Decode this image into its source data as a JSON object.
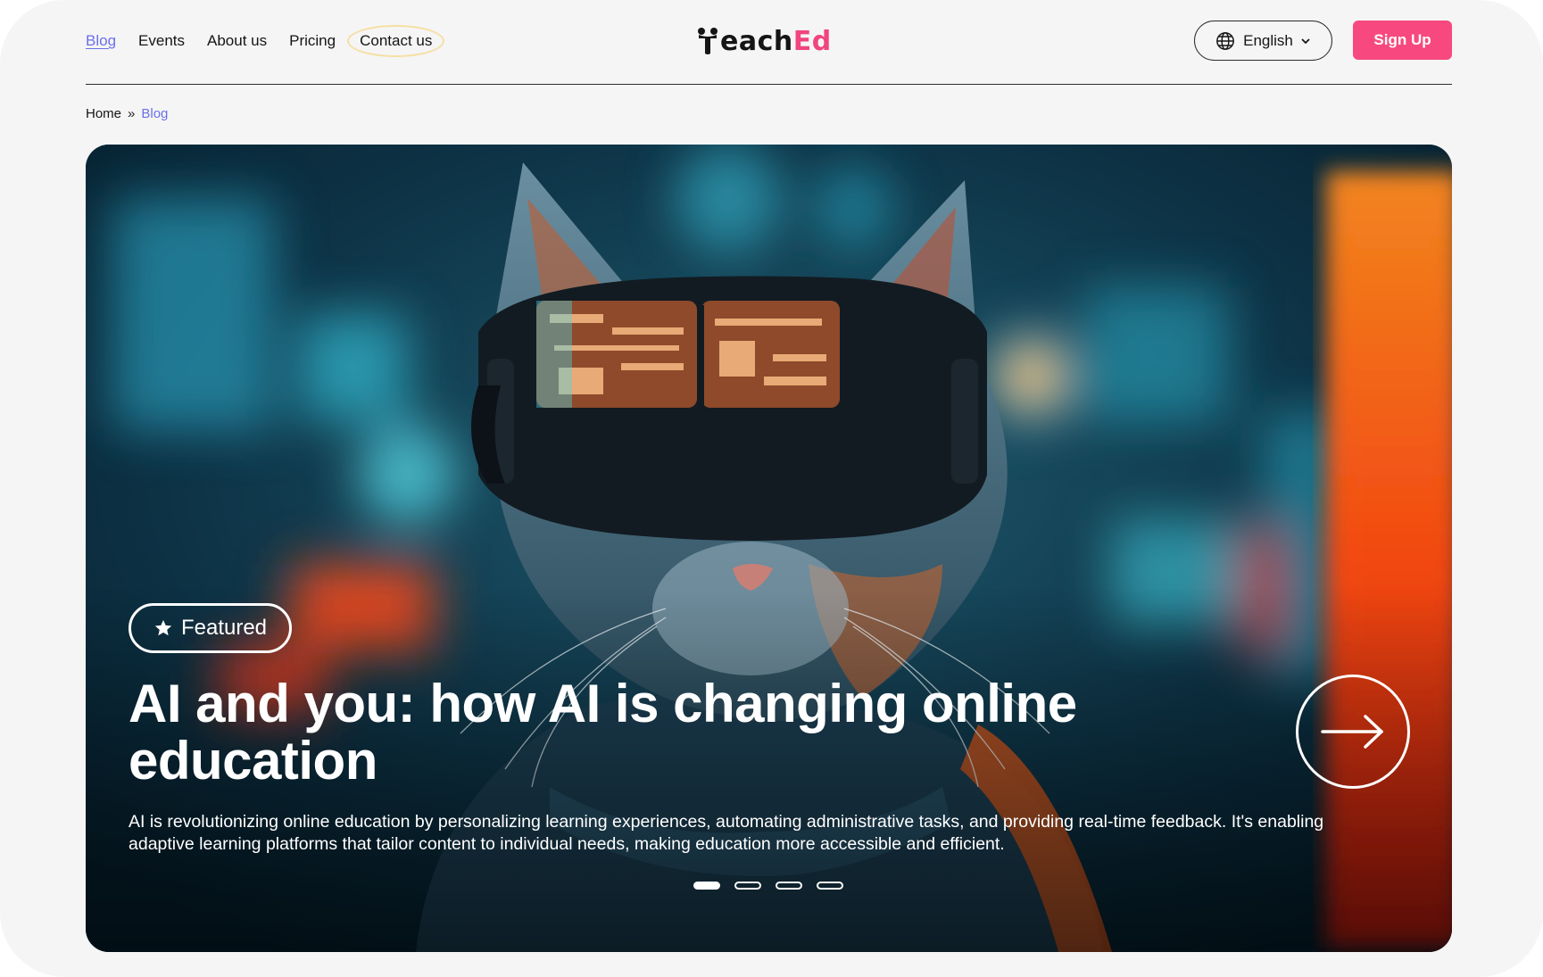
{
  "nav": {
    "items": [
      {
        "label": "Blog",
        "active": true
      },
      {
        "label": "Events"
      },
      {
        "label": "About us"
      },
      {
        "label": "Pricing"
      },
      {
        "label": "Contact us",
        "circled": true
      }
    ]
  },
  "logo": {
    "part1": "each",
    "part2": "Ed",
    "full": "TeachEd"
  },
  "language": {
    "label": "English",
    "icon": "globe-icon"
  },
  "signup": {
    "label": "Sign Up"
  },
  "breadcrumb": {
    "home": "Home",
    "separator": "»",
    "current": "Blog"
  },
  "hero": {
    "badge": "Featured",
    "title": "AI and you: how AI is changing online education",
    "description": "AI is revolutionizing online education by personalizing learning experiences, automating administrative tasks, and providing real-time feedback. It's enabling adaptive learning platforms that tailor content to individual needs, making education more accessible and efficient.",
    "slides_total": 4,
    "active_slide": 1
  },
  "colors": {
    "accent": "#f7497f",
    "link_active": "#6b70e8",
    "background": "#f5f5f5"
  }
}
